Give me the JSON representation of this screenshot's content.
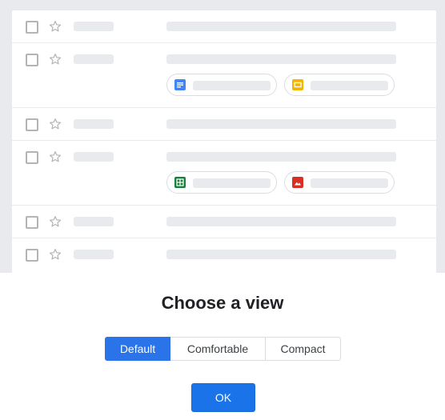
{
  "dialog": {
    "title": "Choose a view",
    "view_options": [
      {
        "label": "Default",
        "selected": true
      },
      {
        "label": "Comfortable",
        "selected": false
      },
      {
        "label": "Compact",
        "selected": false
      }
    ],
    "ok_label": "OK"
  },
  "preview": {
    "rows": [
      {
        "attachments": []
      },
      {
        "attachments": [
          "document-icon",
          "slides-icon"
        ]
      },
      {
        "attachments": []
      },
      {
        "attachments": [
          "sheets-icon",
          "image-icon"
        ]
      },
      {
        "attachments": []
      },
      {
        "attachments": []
      }
    ]
  },
  "colors": {
    "accent": "#1a73e8",
    "selected_segment": "#2b73e8",
    "preview_background": "#e8eaed",
    "placeholder": "#e8eaed"
  }
}
